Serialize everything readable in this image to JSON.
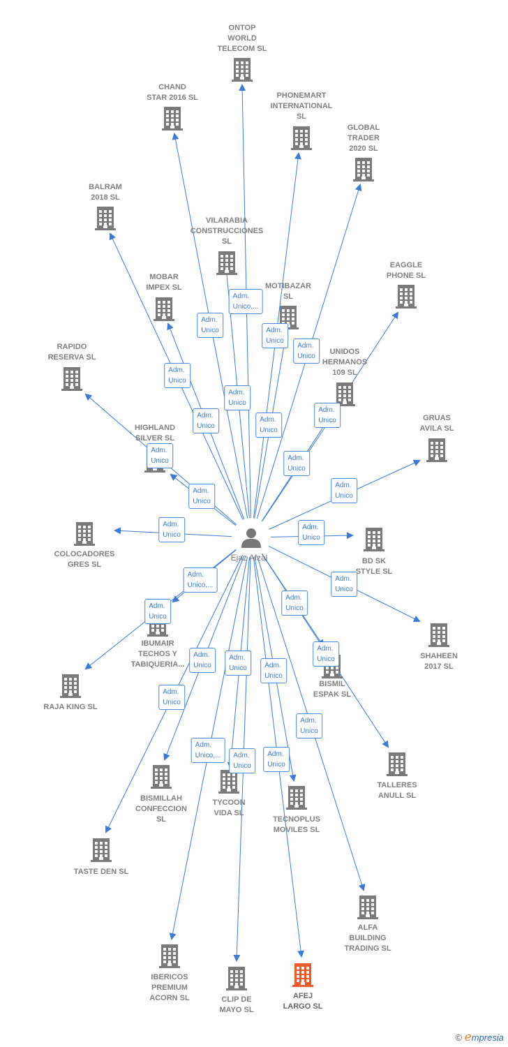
{
  "center": {
    "name": "Ejaz Afzal",
    "icon": "person-icon"
  },
  "colors": {
    "edge": "#3b7ad6",
    "building": "#7a7a7a",
    "highlight": "#f05a28"
  },
  "nodes": [
    {
      "lines": [
        "ONTOP",
        "WORLD",
        "TELECOM  SL"
      ],
      "role": [
        "Adm.",
        "Unico,..."
      ]
    },
    {
      "lines": [
        "CHAND",
        "STAR 2016  SL"
      ],
      "role": [
        "Adm.",
        "Unico"
      ]
    },
    {
      "lines": [
        "PHONEMART",
        "INTERNATIONAL",
        "SL"
      ],
      "role": [
        "Adm.",
        "Unico"
      ]
    },
    {
      "lines": [
        "GLOBAL",
        "TRADER",
        "2020  SL"
      ],
      "role": [
        "Adm.",
        "Unico"
      ]
    },
    {
      "lines": [
        "BALRAM",
        "2018  SL"
      ],
      "role": [
        "Adm.",
        "Unico"
      ]
    },
    {
      "lines": [
        "VILARABIA",
        "CONSTRUCCIONES",
        "SL"
      ],
      "role": [
        "Adm.",
        "Unico"
      ]
    },
    {
      "lines": [
        "MOBAR",
        "IMPEX SL"
      ],
      "role": [
        "Adm.",
        "Unico"
      ]
    },
    {
      "lines": [
        "MOTIBAZAR",
        "SL"
      ],
      "role": [
        "Adm.",
        "Unico"
      ]
    },
    {
      "lines": [
        "EAGGLE",
        "PHONE  SL"
      ],
      "role": [
        "Adm.",
        "Unico"
      ]
    },
    {
      "lines": [
        "RAPIDO",
        "RESERVA  SL"
      ],
      "role": [
        "Adm.",
        "Unico"
      ]
    },
    {
      "lines": [
        "UNIDOS",
        "HERMANOS",
        "109  SL"
      ],
      "role": [
        "Adm.",
        "Unico"
      ]
    },
    {
      "lines": [
        "HIGHLAND",
        "SILVER  SL"
      ],
      "role": [
        "Adm.",
        "Unico"
      ]
    },
    {
      "lines": [
        "GRUAS",
        "AVILA SL"
      ],
      "role": [
        "Adm.",
        "Unico"
      ]
    },
    {
      "lines": [
        "COLOCADORES",
        "GRES  SL"
      ],
      "role": [
        "Adm.",
        "Unico"
      ]
    },
    {
      "lines": [
        "BD SK",
        "STYLE  SL"
      ],
      "role": [
        "Adm.",
        "Unico"
      ]
    },
    {
      "lines": [
        "SHAHEEN",
        "2017  SL"
      ],
      "role": [
        "Adm.",
        "Unico"
      ]
    },
    {
      "lines": [
        "IBUMAIR",
        "TECHOS Y",
        "TABIQUERIA..."
      ],
      "role": [
        "Adm.",
        "Unico,..."
      ]
    },
    {
      "lines": [
        "RAJA KING  SL"
      ],
      "role": [
        "Adm.",
        "Unico"
      ]
    },
    {
      "lines": [
        "BISMIL",
        "ESPAK  SL"
      ],
      "role": [
        "Adm.",
        "Unico"
      ]
    },
    {
      "lines": [
        "TALLERES",
        "ANULL SL"
      ],
      "role": [
        "Adm.",
        "Unico"
      ]
    },
    {
      "lines": [
        "BISMILLAH",
        "CONFECCION",
        "SL"
      ],
      "role": [
        "Adm.",
        "Unico"
      ]
    },
    {
      "lines": [
        "TYCOON",
        "VIDA  SL"
      ],
      "role": [
        "Adm.",
        "Unico"
      ]
    },
    {
      "lines": [
        "TECNOPLUS",
        "MOVILES  SL"
      ],
      "role": [
        "Adm.",
        "Unico"
      ]
    },
    {
      "lines": [
        "TASTE DEN  SL"
      ],
      "role": [
        "Adm.",
        "Unico"
      ]
    },
    {
      "lines": [
        "ALFA",
        "BUILDING",
        "TRADING  SL"
      ],
      "role": [
        "Adm.",
        "Unico"
      ]
    },
    {
      "lines": [
        "IBERICOS",
        "PREMIUM",
        "ACORN  SL"
      ],
      "role": [
        "Adm.",
        "Unico,..."
      ]
    },
    {
      "lines": [
        "CLIP DE",
        "MAYO  SL"
      ],
      "role": [
        "Adm.",
        "Unico"
      ]
    },
    {
      "lines": [
        "AFEJ",
        "LARGO  SL"
      ],
      "role": [
        "Adm.",
        "Unico"
      ],
      "highlight": true
    }
  ],
  "footer": {
    "copyright": "©",
    "brand_initial": "e",
    "brand_rest": "mpresia"
  }
}
